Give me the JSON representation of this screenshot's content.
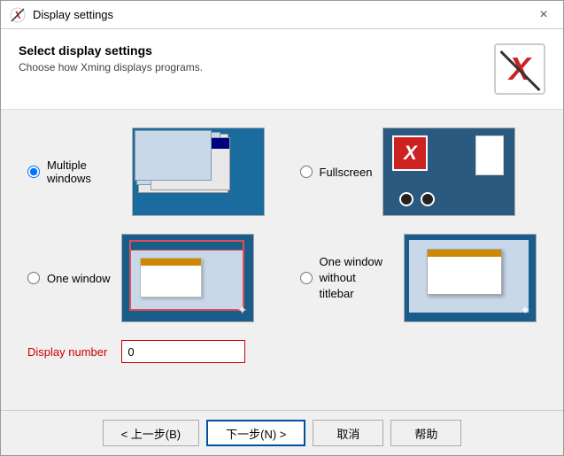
{
  "titleBar": {
    "title": "Display settings",
    "closeLabel": "×"
  },
  "header": {
    "heading": "Select display settings",
    "subtext": "Choose how Xming displays programs."
  },
  "options": [
    {
      "id": "multiple",
      "label": "Multiple windows",
      "checked": true,
      "previewType": "multiple"
    },
    {
      "id": "fullscreen",
      "label": "Fullscreen",
      "checked": false,
      "previewType": "fullscreen"
    },
    {
      "id": "onewindow",
      "label": "One window",
      "checked": false,
      "previewType": "onewindow"
    },
    {
      "id": "notitle",
      "label": "One window\nwithout titlebar",
      "checked": false,
      "previewType": "notitle"
    }
  ],
  "displayNumber": {
    "label": "Display number",
    "value": "0"
  },
  "buttons": {
    "back": "< 上一步(B)",
    "next": "下一步(N) >",
    "cancel": "取消",
    "help": "帮助"
  }
}
